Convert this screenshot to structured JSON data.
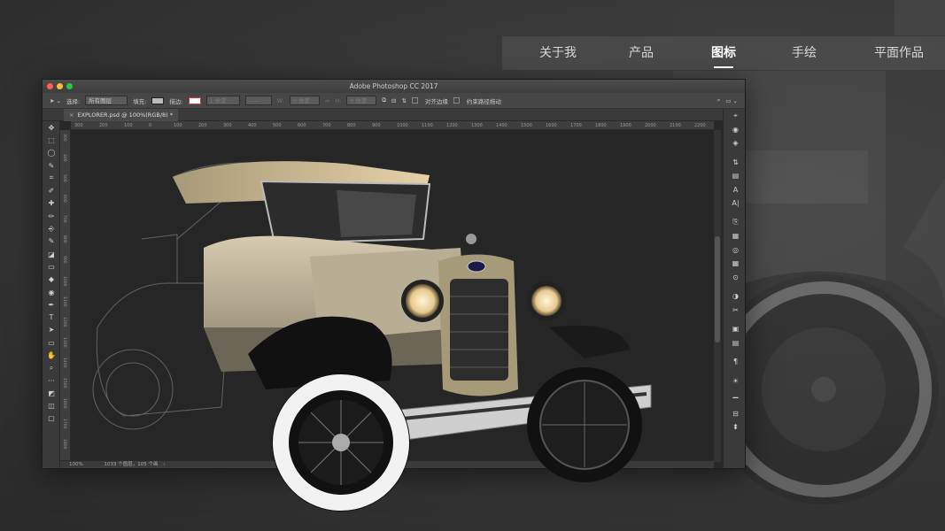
{
  "site_nav": {
    "items": [
      {
        "label": "关于我",
        "active": false
      },
      {
        "label": "产品",
        "active": false
      },
      {
        "label": "图标",
        "active": true
      },
      {
        "label": "手绘",
        "active": false
      },
      {
        "label": "平面作品",
        "active": false
      }
    ]
  },
  "photoshop": {
    "window_title": "Adobe Photoshop CC 2017",
    "options_bar": {
      "select_label": "选择:",
      "select_value": "所有图层",
      "fill_label": "填充:",
      "stroke_label": "描边:",
      "stroke_width": "1 像素",
      "w_label": "W:",
      "w_value": "0 像素",
      "link_icon": "∞",
      "h_label": "H:",
      "h_value": "0 像素",
      "align_edges_label": "对齐边缘",
      "constrain_path_label": "约束路径拖动"
    },
    "document_tab": {
      "title": "EXPLORER.psd @ 100%(RGB/8) *",
      "close": "×"
    },
    "ruler_top_ticks": [
      "300",
      "200",
      "100",
      "0",
      "100",
      "200",
      "300",
      "400",
      "500",
      "600",
      "700",
      "800",
      "900",
      "1000",
      "1100",
      "1200",
      "1300",
      "1400",
      "1500",
      "1600",
      "1700",
      "1800",
      "1900",
      "2000",
      "2100",
      "2200"
    ],
    "ruler_left_ticks": [
      "300",
      "400",
      "500",
      "600",
      "700",
      "800",
      "900",
      "1000",
      "1100",
      "1200",
      "1300",
      "1400",
      "1500",
      "1600",
      "1700",
      "1800"
    ],
    "status": {
      "zoom": "100%",
      "info": "1033 个图层，105 个画"
    },
    "left_tools": [
      "move-tool",
      "marquee-tool",
      "lasso-tool",
      "quick-select-tool",
      "crop-tool",
      "eyedropper-tool",
      "healing-tool",
      "brush-tool",
      "stamp-tool",
      "history-brush-tool",
      "eraser-tool",
      "gradient-tool",
      "blur-tool",
      "dodge-tool",
      "pen-tool",
      "type-tool",
      "path-select-tool",
      "rectangle-tool",
      "hand-tool",
      "zoom-tool",
      "more-tools",
      "color-swatches",
      "quick-mask",
      "screen-mode"
    ],
    "left_tool_glyphs": [
      "✥",
      "⬚",
      "◯",
      "✎",
      "⌗",
      "✐",
      "✚",
      "✏",
      "⎆",
      "✎",
      "◪",
      "▭",
      "◆",
      "◉",
      "✒",
      "T",
      "➤",
      "▭",
      "✋",
      "⌕",
      "···",
      "◩",
      "◫",
      "▢"
    ],
    "right_panel_icons": [
      "path-icon",
      "color-icon",
      "layers-icon",
      "adjust-icon",
      "brush-settings-icon",
      "character-icon",
      "paragraph-icon",
      "library-icon",
      "styles-icon",
      "3d-icon",
      "grid-icon",
      "info-icon",
      "mask-icon",
      "tools-icon",
      "channels-icon",
      "properties-icon",
      "paragraph-mark-icon",
      "sun-icon",
      "histogram-icon",
      "align-icon",
      "clone-source-icon"
    ],
    "right_panel_glyphs": [
      "⌖",
      "◉",
      "◈",
      "⇅",
      "▤",
      "A",
      "A|",
      "⎘",
      "▦",
      "◎",
      "▦",
      "⊙",
      "◑",
      "✂",
      "▣",
      "▤",
      "¶",
      "☀",
      "▁",
      "⊟",
      "⬍"
    ]
  }
}
